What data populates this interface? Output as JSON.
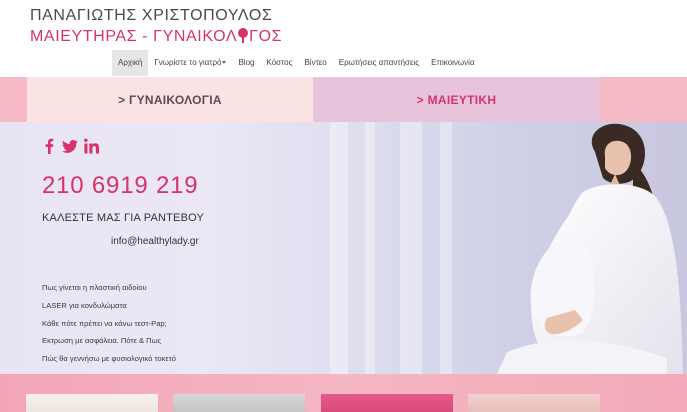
{
  "logo": {
    "line1": "ΠΑΝΑΓΙΩΤΗΣ ΧΡΙΣΤΟΠΟΥΛΟΣ",
    "line2_before": "ΜΑΙΕΥΤΗΡΑΣ - ΓΥΝΑΙΚΟΛ",
    "line2_after": "ΓΟΣ"
  },
  "nav": {
    "items": [
      {
        "label": "Αρχική"
      },
      {
        "label": "Γνωρίστε το γιατρό"
      },
      {
        "label": "Blog"
      },
      {
        "label": "Κόστος"
      },
      {
        "label": "Βίντεο"
      },
      {
        "label": "Ερωτήσεις απαντήσεις"
      },
      {
        "label": "Επικοινωνία"
      }
    ]
  },
  "sections": {
    "gynecology": "> ΓΥΝΑΙΚΟΛΟΓΙΑ",
    "obstetrics": "> ΜΑΙΕΥΤΙΚΗ"
  },
  "contact": {
    "phone": "210 6919 219",
    "cta": "ΚΑΛΕΣΤΕ ΜΑΣ ΓΙΑ ΡΑΝΤΕΒΟΥ",
    "email": "info@healthylady.gr"
  },
  "social": [
    "facebook-icon",
    "twitter-icon",
    "linkedin-icon"
  ],
  "links": [
    "Πως γίνεται η πλαστική αιδοίου",
    "LASER για κονδυλώματα",
    "Κάθε πότε πρέπει να κάνω τεστ-Pap;",
    "Εκτρωση με ασφάλεια. Πότε & Πως",
    "Πώς θα γεννήσω με φυσιολογικό τοκετό"
  ],
  "colors": {
    "accent": "#d6336c",
    "band_pink": "#f5b9c4",
    "gyn_tile": "#fbe3e3",
    "obs_tile": "#e7c4dc"
  }
}
